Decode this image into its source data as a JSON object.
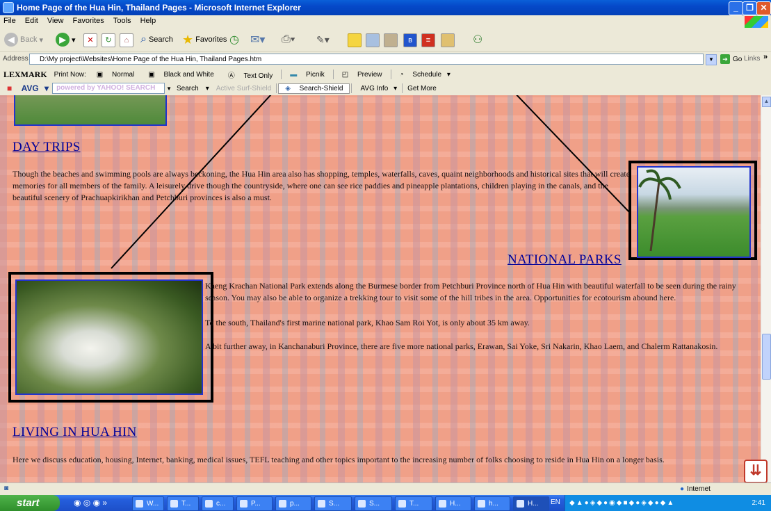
{
  "window": {
    "title": "Home Page of the Hua Hin, Thailand Pages - Microsoft Internet Explorer"
  },
  "menu": [
    "File",
    "Edit",
    "View",
    "Favorites",
    "Tools",
    "Help"
  ],
  "toolbar": {
    "back": "Back",
    "search": "Search",
    "favorites": "Favorites"
  },
  "address": {
    "label": "Address",
    "value": "D:\\My project\\Websites\\Home Page of the Hua Hin, Thailand Pages.htm",
    "go": "Go",
    "links": "Links"
  },
  "lexmark": {
    "brand": "LEXMARK",
    "print_now": "Print Now:",
    "normal": "Normal",
    "bw": "Black and White",
    "text_only": "Text Only",
    "picnik": "Picnik",
    "preview": "Preview",
    "schedule": "Schedule"
  },
  "avg": {
    "brand": "AVG",
    "yahoo_placeholder": "powered by YAHOO! SEARCH",
    "search": "Search",
    "active_surf": "Active Surf-Shield",
    "search_shield": "Search-Shield",
    "avg_info": "AVG Info",
    "get_more": "Get More"
  },
  "content": {
    "day_trips": {
      "heading": "DAY TRIPS",
      "text": "Though the beaches and swimming pools are always beckoning, the Hua Hin area also has shopping, temples, waterfalls, caves, quaint neighborhoods and historical sites that will create memories for all members of the family. A leisurely drive though the countryside, where one can see rice paddies and pineapple plantations, children playing in the canals, and the beautiful scenery of Prachuapkirikhan and Petchburi provinces is also a must."
    },
    "national_parks": {
      "heading": "NATIONAL PARKS",
      "p1": "Kaeng Krachan National Park extends along the Burmese border from Petchburi Province north of Hua Hin with beautiful waterfall to be seen during the rainy season. You may also be able to organize a trekking tour to visit some of the hill tribes in the area. Opportunities for ecotourism abound here.",
      "p2": "To the south, Thailand's first marine national park, Khao Sam Roi Yot, is only about 35 km away.",
      "p3": "A bit further away, in Kanchanaburi Province, there are five more national parks, Erawan, Sai Yoke, Sri Nakarin, Khao Laem, and Chalerm Rattanakosin."
    },
    "living": {
      "heading": "LIVING IN HUA HIN",
      "text": "Here we discuss education, housing, Internet, banking, medical issues, TEFL teaching and other topics important to the increasing number of folks choosing to reside in Hua Hin on a longer basis."
    }
  },
  "status": {
    "zone": "Internet"
  },
  "taskbar": {
    "start": "start",
    "tasks": [
      "W...",
      "T...",
      "c...",
      "P...",
      "p...",
      "S...",
      "S...",
      "T...",
      "H...",
      "h...",
      "H..."
    ],
    "lang": "EN",
    "clock": "2:41"
  }
}
